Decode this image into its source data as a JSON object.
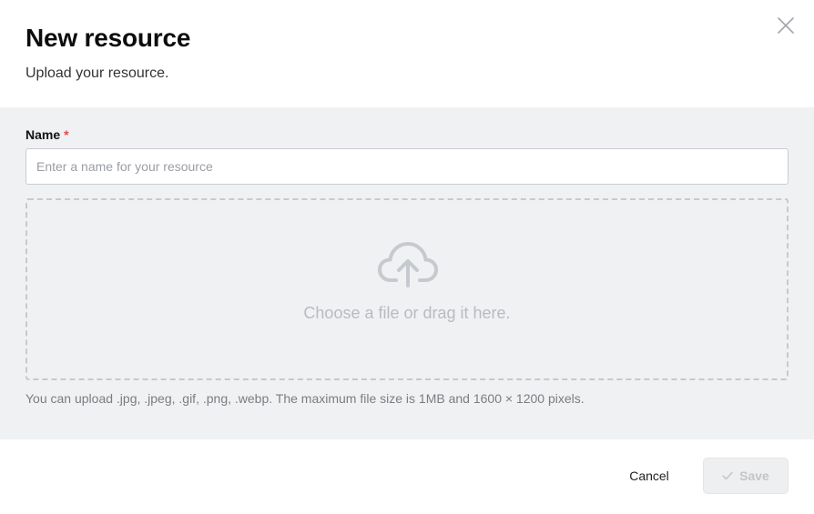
{
  "dialog": {
    "title": "New resource",
    "subtitle": "Upload your resource.",
    "close_icon": "close-icon"
  },
  "form": {
    "name_label": "Name",
    "required_marker": "*",
    "name_value": "",
    "name_placeholder": "Enter a name for your resource"
  },
  "upload": {
    "icon": "cloud-upload-icon",
    "prompt": "Choose a file or drag it here.",
    "hint": "You can upload .jpg, .jpeg, .gif, .png, .webp. The maximum file size is 1MB and 1600 × 1200 pixels."
  },
  "footer": {
    "cancel_label": "Cancel",
    "save_label": "Save",
    "save_icon": "check-icon",
    "save_disabled": true
  },
  "colors": {
    "required": "#e5484d",
    "body_background": "#f0f1f3",
    "disabled_text": "#c3c5c9"
  }
}
